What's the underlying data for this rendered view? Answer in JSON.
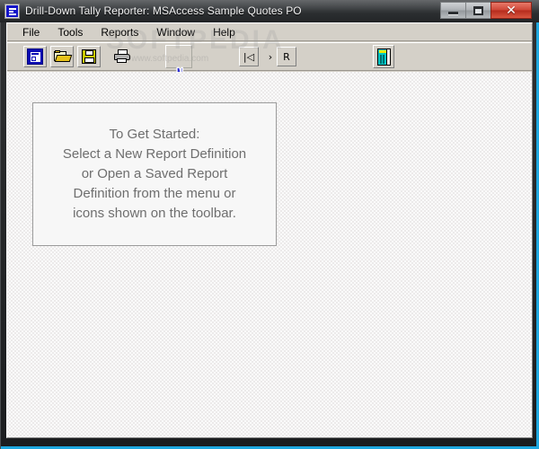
{
  "window": {
    "title": "Drill-Down Tally Reporter: MSAccess Sample Quotes PO",
    "app_icon": "report-window-icon",
    "controls": {
      "minimize_label": "",
      "maximize_label": "",
      "close_label": "✕"
    },
    "accent_color": "#1fa8e0",
    "titlebar_color": "#3a3d40",
    "close_button_color": "#cf4636"
  },
  "menubar": {
    "items": [
      {
        "label": "File",
        "name": "menu-file"
      },
      {
        "label": "Tools",
        "name": "menu-tools"
      },
      {
        "label": "Reports",
        "name": "menu-reports"
      },
      {
        "label": "Window",
        "name": "menu-window"
      },
      {
        "label": "Help",
        "name": "menu-help"
      }
    ]
  },
  "toolbar": {
    "buttons": [
      {
        "name": "new-report-definition-icon",
        "tip": "New Report Definition"
      },
      {
        "name": "open-folder-icon",
        "tip": "Open Saved Report Definition"
      },
      {
        "name": "save-icon",
        "tip": "Save"
      },
      {
        "name": "print-icon",
        "tip": "Print"
      }
    ],
    "nav": [
      {
        "name": "first-record-icon",
        "label": "|◁"
      },
      {
        "name": "next-record-icon",
        "label": "›"
      },
      {
        "name": "last-record-icon",
        "label": "R"
      }
    ],
    "report_button": {
      "name": "report-preview-icon",
      "tip": "Report"
    }
  },
  "main": {
    "panel": {
      "lines": [
        "To Get Started:",
        "Select a New Report Definition",
        "or Open a Saved Report",
        "Definition from the menu or",
        "icons shown on the toolbar."
      ],
      "text_color": "#6e6e6e",
      "background": "#f7f7f7"
    }
  },
  "watermark": {
    "main": "SOFTPEDIA",
    "sub": "www.softpedia.com"
  }
}
